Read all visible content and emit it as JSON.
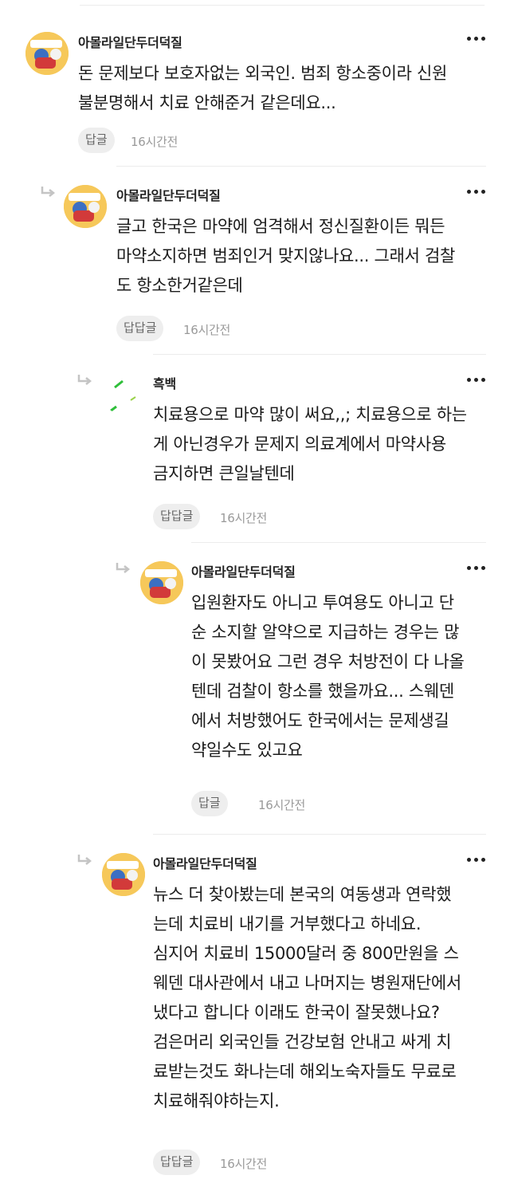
{
  "comments": [
    {
      "author": "아몰라일단두더덕질",
      "lines": [
        "돈 문제보다 보호자없는 외국인. 범죄 항소중이라 신원",
        "불분명해서 치료 안해준거 같은데요..."
      ],
      "reply_label": "답글",
      "time": "16시간전"
    },
    {
      "author": "아몰라일단두더덕질",
      "lines": [
        "글고 한국은 마약에 엄격해서 정신질환이든 뭐든",
        "마약소지하면 범죄인거 맞지않나요... 그래서 검찰",
        "도 항소한거같은데"
      ],
      "reply_label": "답답글",
      "time": "16시간전"
    },
    {
      "author": "흑백",
      "lines": [
        "치료용으로 마약 많이 써요,,; 치료용으로 하는",
        "게 아닌경우가 문제지 의료계에서 마약사용",
        "금지하면 큰일날텐데"
      ],
      "reply_label": "답답글",
      "time": "16시간전"
    },
    {
      "author": "아몰라일단두더덕질",
      "lines": [
        "입원환자도 아니고 투여용도 아니고 단",
        "순 소지할 알약으로 지급하는 경우는 많",
        "이 못봤어요 그런 경우 처방전이 다 나올",
        "텐데 검찰이 항소를 했을까요... 스웨덴",
        "에서 처방했어도 한국에서는 문제생길",
        "약일수도 있고요"
      ],
      "reply_label": "답글",
      "time": "16시간전"
    },
    {
      "author": "아몰라일단두더덕질",
      "lines": [
        "뉴스 더 찾아봤는데 본국의 여동생과 연락했",
        "는데 치료비 내기를 거부했다고 하네요.",
        "심지어 치료비 15000달러 중 800만원을 스",
        "웨덴 대사관에서 내고 나머지는 병원재단에서",
        "냈다고 합니다 이래도 한국이 잘못했나요?",
        "검은머리 외국인들 건강보험 안내고 싸게 치",
        "료받는것도 화나는데 해외노숙자들도 무료로",
        "치료해줘야하는지."
      ],
      "reply_label": "답답글",
      "time": "16시간전"
    }
  ],
  "icons": {
    "more": "more-horizontal-icon",
    "reply_arrow": "reply-arrow-icon",
    "avatar_cartoon": "cartoon-avatar",
    "avatar_dashes": "green-dash-avatar"
  },
  "colors": {
    "avatar_bg": "#f6c85a",
    "dash_green": "#2fbf3a",
    "reply_btn_bg": "#eeeeee",
    "time": "#9a9a9a"
  }
}
